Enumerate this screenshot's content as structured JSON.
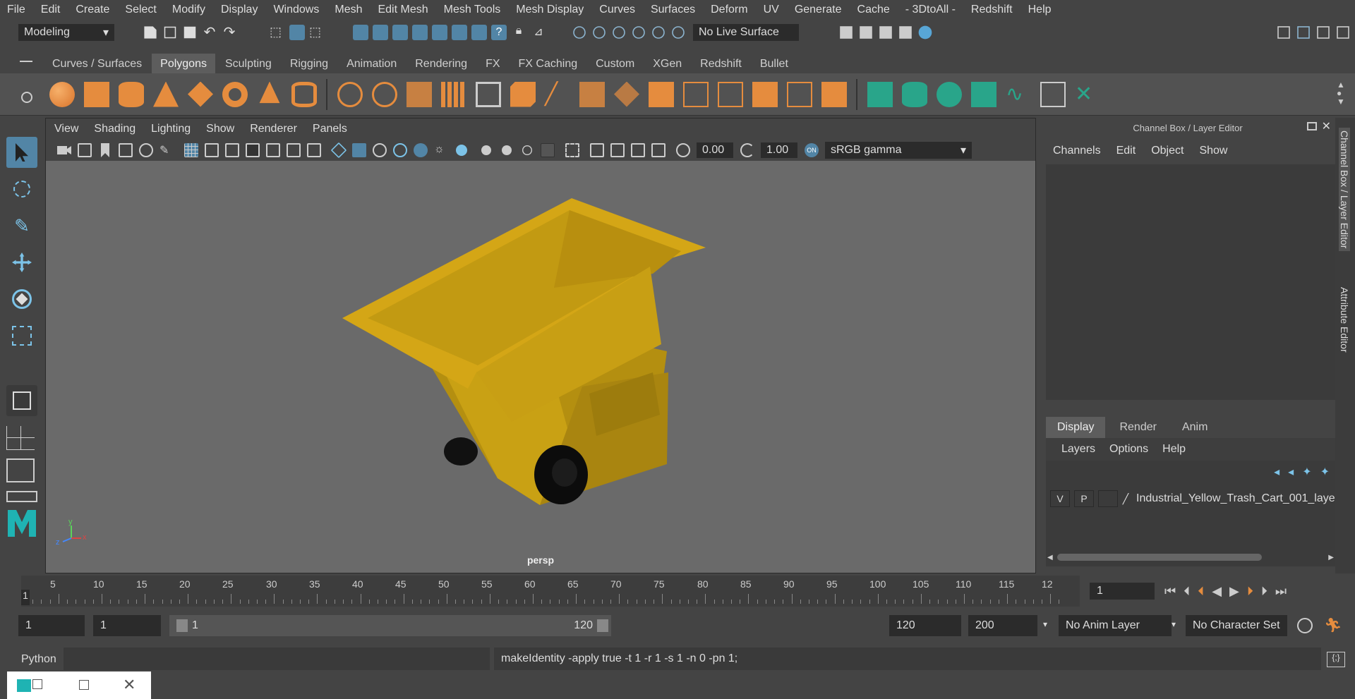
{
  "menubar": [
    "File",
    "Edit",
    "Create",
    "Select",
    "Modify",
    "Display",
    "Windows",
    "Mesh",
    "Edit Mesh",
    "Mesh Tools",
    "Mesh Display",
    "Curves",
    "Surfaces",
    "Deform",
    "UV",
    "Generate",
    "Cache",
    "- 3DtoAll -",
    "Redshift",
    "Help"
  ],
  "statusline": {
    "workspace": "Modeling",
    "live_surface": "No Live Surface"
  },
  "shelf_tabs": [
    "Curves / Surfaces",
    "Polygons",
    "Sculpting",
    "Rigging",
    "Animation",
    "Rendering",
    "FX",
    "FX Caching",
    "Custom",
    "XGen",
    "Redshift",
    "Bullet"
  ],
  "shelf_active": "Polygons",
  "viewport": {
    "menu": [
      "View",
      "Shading",
      "Lighting",
      "Show",
      "Renderer",
      "Panels"
    ],
    "exposure": "0.00",
    "gamma": "1.00",
    "color_space": "sRGB gamma",
    "camera": "persp",
    "axis_x": "x",
    "axis_y": "y",
    "axis_z": "z"
  },
  "channel_box": {
    "title": "Channel Box / Layer Editor",
    "menu": [
      "Channels",
      "Edit",
      "Object",
      "Show"
    ]
  },
  "layer_editor": {
    "tabs": [
      "Display",
      "Render",
      "Anim"
    ],
    "menu": [
      "Layers",
      "Options",
      "Help"
    ],
    "layer": {
      "v": "V",
      "p": "P",
      "name": "Industrial_Yellow_Trash_Cart_001_laye"
    }
  },
  "side_tabs": [
    "Channel Box / Layer Editor",
    "Attribute Editor"
  ],
  "timeline": {
    "ticks": [
      "5",
      "10",
      "15",
      "20",
      "25",
      "30",
      "35",
      "40",
      "45",
      "50",
      "55",
      "60",
      "65",
      "70",
      "75",
      "80",
      "85",
      "90",
      "95",
      "100",
      "105",
      "110",
      "115",
      "12"
    ],
    "current": "1",
    "current_frame_field": "1"
  },
  "range": {
    "start": "1",
    "start2": "1",
    "slider_start": "1",
    "slider_end": "120",
    "end": "120",
    "end2": "200",
    "anim_layer": "No Anim Layer",
    "char_set": "No Character Set"
  },
  "command": {
    "lang": "Python",
    "output": "makeIdentity -apply true -t 1 -r 1 -s 1 -n 0 -pn 1;"
  },
  "colors": {
    "cart_yellow": "#d4a616",
    "accent_blue": "#5285a6",
    "bg": "#444444",
    "viewport": "#6a6a6a"
  }
}
